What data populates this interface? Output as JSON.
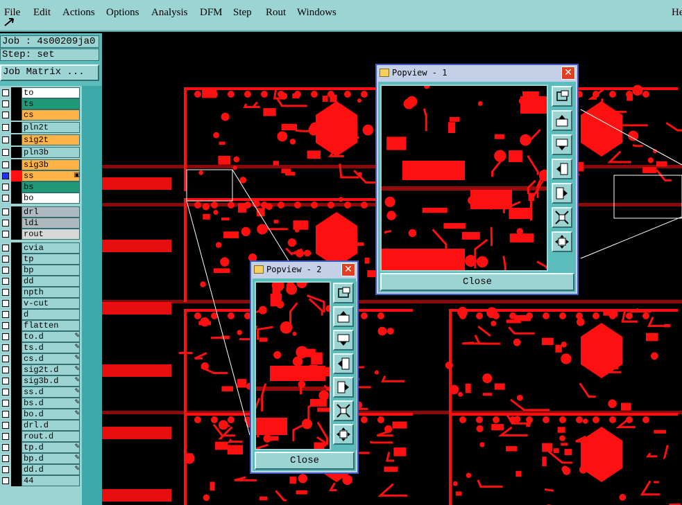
{
  "menu": {
    "items": [
      "File",
      "Edit",
      "Actions",
      "Options",
      "Analysis",
      "DFM",
      "Step",
      "Rout",
      "Windows"
    ],
    "right_label": "He"
  },
  "job": {
    "label": "Job : 4s00209ja0",
    "step": "Step: set",
    "matrix_button": "Job Matrix ..."
  },
  "layers": [
    {
      "name": "to",
      "color": "#ffffff",
      "mark": ""
    },
    {
      "name": "ts",
      "color": "#1f9a78",
      "mark": ""
    },
    {
      "name": "cs",
      "color": "#ffb347",
      "mark": ""
    },
    {
      "name": "pln2t",
      "color": "#9cd3d3",
      "mark": ""
    },
    {
      "name": "sig2t",
      "color": "#ffb347",
      "mark": ""
    },
    {
      "name": "pln3b",
      "color": "#9cd3d3",
      "mark": ""
    },
    {
      "name": "sig3b",
      "color": "#ffb347",
      "mark": ""
    },
    {
      "name": "ss",
      "color": "#ffb347",
      "mark": "▣",
      "selected": true
    },
    {
      "name": "bs",
      "color": "#1f9a78",
      "mark": ""
    },
    {
      "name": "bo",
      "color": "#ffffff",
      "mark": ""
    },
    {
      "name": "drl",
      "color": "#b0b8c0",
      "mark": ""
    },
    {
      "name": "ldi",
      "color": "#b0b8c0",
      "mark": ""
    },
    {
      "name": "rout",
      "color": "#d8d8d8",
      "mark": ""
    },
    {
      "name": "cvia",
      "color": "#9cd3d3",
      "mark": ""
    },
    {
      "name": "tp",
      "color": "#9cd3d3",
      "mark": ""
    },
    {
      "name": "bp",
      "color": "#9cd3d3",
      "mark": ""
    },
    {
      "name": "dd",
      "color": "#9cd3d3",
      "mark": ""
    },
    {
      "name": "npth",
      "color": "#9cd3d3",
      "mark": ""
    },
    {
      "name": "v-cut",
      "color": "#9cd3d3",
      "mark": ""
    },
    {
      "name": "d",
      "color": "#9cd3d3",
      "mark": ""
    },
    {
      "name": "flatten",
      "color": "#9cd3d3",
      "mark": ""
    },
    {
      "name": "to.d",
      "color": "#9cd3d3",
      "mark": "✎"
    },
    {
      "name": "ts.d",
      "color": "#9cd3d3",
      "mark": "✎"
    },
    {
      "name": "cs.d",
      "color": "#9cd3d3",
      "mark": "✎"
    },
    {
      "name": "sig2t.d",
      "color": "#9cd3d3",
      "mark": "✎"
    },
    {
      "name": "sig3b.d",
      "color": "#9cd3d3",
      "mark": "✎"
    },
    {
      "name": "ss.d",
      "color": "#9cd3d3",
      "mark": "✎"
    },
    {
      "name": "bs.d",
      "color": "#9cd3d3",
      "mark": "✎"
    },
    {
      "name": "bo.d",
      "color": "#9cd3d3",
      "mark": "✎"
    },
    {
      "name": "drl.d",
      "color": "#9cd3d3",
      "mark": ""
    },
    {
      "name": "rout.d",
      "color": "#9cd3d3",
      "mark": ""
    },
    {
      "name": "tp.d",
      "color": "#9cd3d3",
      "mark": "✎"
    },
    {
      "name": "bp.d",
      "color": "#9cd3d3",
      "mark": "✎"
    },
    {
      "name": "dd.d",
      "color": "#9cd3d3",
      "mark": "✎"
    },
    {
      "name": "44",
      "color": "#9cd3d3",
      "mark": ""
    }
  ],
  "popup1": {
    "title": "Popview - 1",
    "close_label": "Close"
  },
  "popup2": {
    "title": "Popview - 2",
    "close_label": "Close"
  },
  "colors": {
    "copper": "#ff1010",
    "panel": "#9cd3d3",
    "teal": "#5cbcbc"
  }
}
